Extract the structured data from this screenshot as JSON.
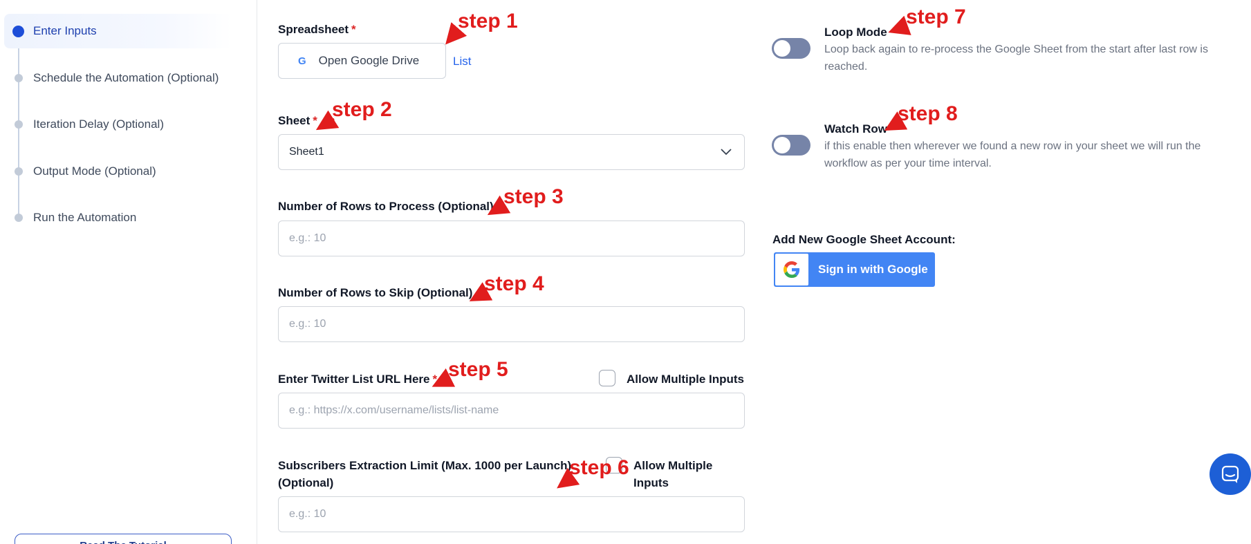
{
  "sidebar": {
    "steps": [
      {
        "label": "Enter Inputs",
        "active": true
      },
      {
        "label": "Schedule the Automation (Optional)",
        "active": false
      },
      {
        "label": "Iteration Delay (Optional)",
        "active": false
      },
      {
        "label": "Output Mode (Optional)",
        "active": false
      },
      {
        "label": "Run the Automation",
        "active": false
      }
    ],
    "tutorial_button": "Read The Tutorial"
  },
  "form": {
    "spreadsheet": {
      "label": "Spreadsheet",
      "required_mark": "*",
      "button_label": "Open Google Drive",
      "google_glyph": "G",
      "list_link": "List"
    },
    "sheet": {
      "label": "Sheet",
      "required_mark": "*",
      "value": "Sheet1"
    },
    "rows_to_process": {
      "label": "Number of Rows to Process (Optional)",
      "placeholder": "e.g.: 10"
    },
    "rows_to_skip": {
      "label": "Number of Rows to Skip (Optional)",
      "placeholder": "e.g.: 10"
    },
    "twitter_list_url": {
      "label": "Enter Twitter List URL Here",
      "required_mark": "*",
      "placeholder": "e.g.: https://x.com/username/lists/list-name",
      "allow_multiple_label": "Allow Multiple Inputs"
    },
    "subscribers_limit": {
      "label_line1": "Subscribers Extraction Limit (Max. 1000 per Launch)",
      "label_line2": "(Optional)",
      "placeholder": "e.g.: 10",
      "allow_multiple_line1": "Allow Multiple",
      "allow_multiple_line2": "Inputs"
    }
  },
  "options": {
    "loop_mode": {
      "title": "Loop Mode",
      "description": "Loop back again to re-process the Google Sheet from the start after last row is reached.",
      "enabled": false
    },
    "watch_row": {
      "title": "Watch Row",
      "description": "if this enable then wherever we found a new row in your sheet we will run the workflow as per your time interval.",
      "enabled": false
    }
  },
  "google_account": {
    "label": "Add New Google Sheet Account:",
    "button_label": "Sign in with Google"
  },
  "annotations": [
    "step 1",
    "step 2",
    "step 3",
    "step 4",
    "step 5",
    "step 6",
    "step 7",
    "step 8"
  ],
  "colors": {
    "accent": "#1d4ed8",
    "annotation": "#e11d1d",
    "google_blue": "#4285f4",
    "toggle_off": "#7684a8"
  }
}
